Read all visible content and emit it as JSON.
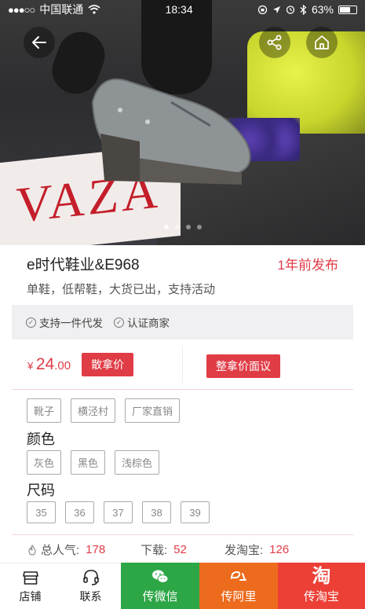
{
  "status_bar": {
    "signal": "●●●○○",
    "carrier": "中国联通",
    "time": "18:34",
    "battery": "63%",
    "battery_level": 0.63
  },
  "hero": {
    "image_alt": "grey lace-up platform shoe",
    "slide_count": 4,
    "active_slide": 1,
    "magazine_text": "VAZA"
  },
  "header": {
    "back_icon": "back-arrow-icon",
    "share_icon": "share-icon",
    "home_icon": "home-icon"
  },
  "product": {
    "title": "e时代鞋业&E968",
    "post_time": "1年前发布",
    "subtitle": "单鞋，低帮鞋，大货已出，支持活动"
  },
  "badges": [
    {
      "label": "支持一件代发",
      "icon": "check-circle-icon"
    },
    {
      "label": "认证商家",
      "icon": "check-circle-icon"
    }
  ],
  "price": {
    "currency": "¥",
    "amount": "24",
    "cents": ".00",
    "retail_button": "散拿价",
    "wholesale_button": "整拿价面议"
  },
  "tags": [
    "靴子",
    "横泾村",
    "厂家直销"
  ],
  "color_section": {
    "label": "颜色",
    "options": [
      "灰色",
      "黑色",
      "浅棕色"
    ]
  },
  "size_section": {
    "label": "尺码",
    "options": [
      "35",
      "36",
      "37",
      "38",
      "39"
    ]
  },
  "stats": {
    "popularity_label": "总人气:",
    "popularity_value": "178",
    "downloads_label": "下载:",
    "downloads_value": "52",
    "taobao_label": "发淘宝:",
    "taobao_value": "126"
  },
  "bottom_nav": {
    "shop": {
      "label": "店铺",
      "icon": "shop-icon"
    },
    "contact": {
      "label": "联系",
      "icon": "headset-icon"
    },
    "wechat": {
      "label": "传微信",
      "icon": "wechat-icon",
      "color": "#2da646"
    },
    "alibaba": {
      "label": "传阿里",
      "icon": "alibaba-icon",
      "color": "#ed6b1d"
    },
    "taobao": {
      "label": "传淘宝",
      "icon": "taobao-icon",
      "glyph": "淘",
      "color": "#ec3f36"
    }
  },
  "colors": {
    "accent_red": "#e03c46",
    "wechat_green": "#2da646",
    "alibaba_orange": "#ed6b1d",
    "taobao_red": "#ec3f36"
  }
}
